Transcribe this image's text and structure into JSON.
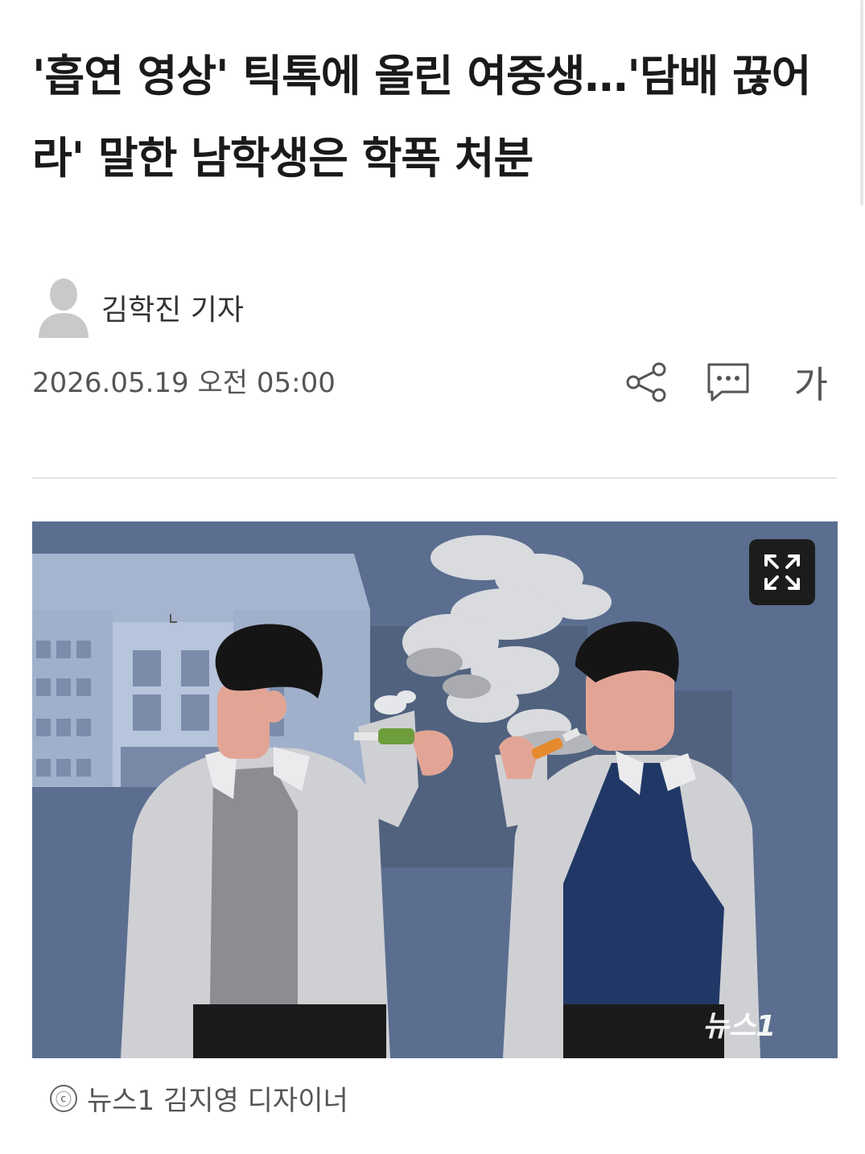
{
  "article": {
    "headline": "'흡연 영상' 틱톡에 올린 여중생…'담배 끊어라' 말한 남학생은 학폭 처분",
    "reporter": "김학진 기자",
    "datetime": "2026.05.19 오전 05:00"
  },
  "actions": {
    "share_icon": "share-icon",
    "comment_icon": "comment-icon",
    "font_size_label": "가"
  },
  "figure": {
    "expand_icon": "expand-icon",
    "watermark": "뉴스1",
    "caption_symbol": "ⓒ",
    "caption": "뉴스1 김지영 디자이너"
  },
  "colors": {
    "figure_background": "#5b6e90",
    "building": "#a5b5d0",
    "vest": "#213866"
  }
}
